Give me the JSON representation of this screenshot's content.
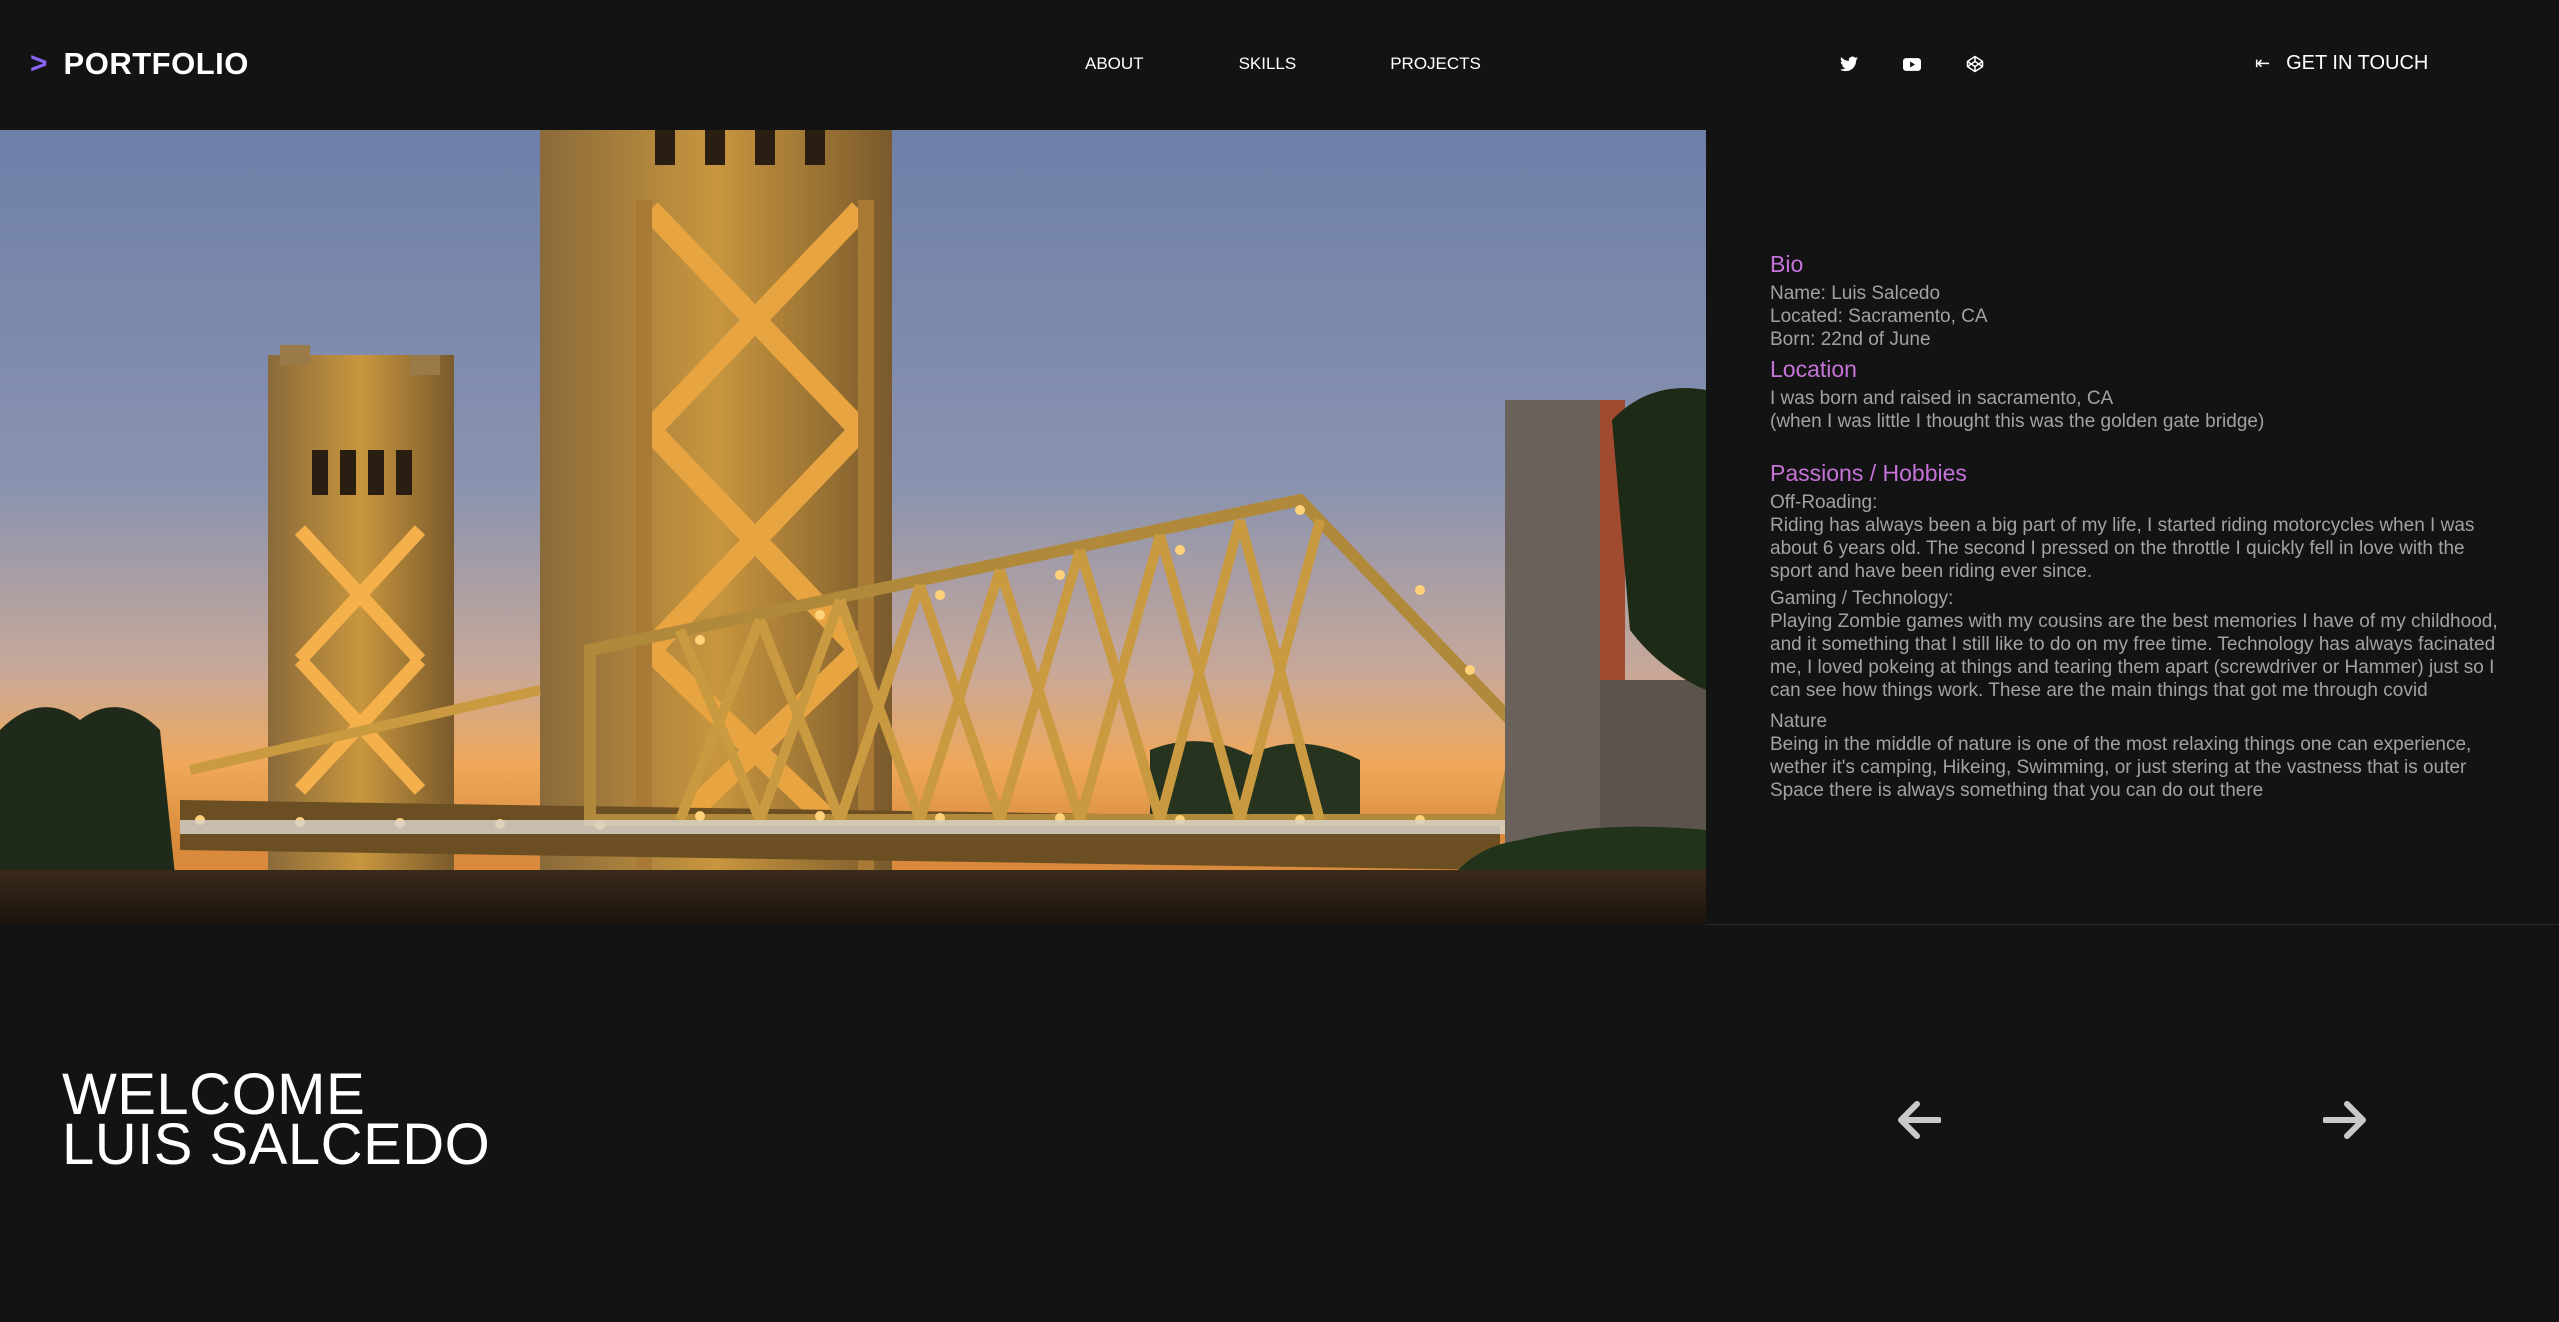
{
  "header": {
    "brand_arrow": ">",
    "brand_name": "PORTFOLIO",
    "nav": {
      "about": "ABOUT",
      "skills": "SKILLS",
      "projects": "PROJECTS"
    },
    "social_icons": [
      "twitter-icon",
      "youtube-icon",
      "codepen-icon"
    ],
    "cta_icon": "⇤",
    "cta_label": "GET IN TOUCH"
  },
  "bio": {
    "bio_heading": "Bio",
    "name_line": "Name: Luis Salcedo",
    "located_line": "Located: Sacramento, CA",
    "born_line": "Born: 22nd of June",
    "location_heading": "Location",
    "location_line1": "I was born and raised in sacramento, CA",
    "location_line2": "(when I was little I thought this was the golden gate bridge)",
    "passions_heading": "Passions / Hobbies",
    "offroading_title": "Off-Roading:",
    "offroading_text": "Riding has always been a big part of my life, I started riding motorcycles when I was about 6 years old. The second I pressed on the throttle I quickly fell in love with the sport and have been riding ever since.",
    "gaming_title": "Gaming / Technology:",
    "gaming_text": "Playing Zombie games with my cousins are the best memories I have of my childhood, and it something that I still like to do on my free time. Technology has always facinated me, I loved pokeing at things and tearing them apart (screwdriver or Hammer) just so I can see how things work. These are the main things that got me through covid",
    "nature_title": "Nature",
    "nature_text": "Being in the middle of nature is one of the most relaxing things one can experience, wether it's camping, Hikeing, Swimming, or just stering at the vastness that is outer Space there is always something that you can do out there"
  },
  "welcome": {
    "line1": "WELCOME",
    "line2": "LUIS SALCEDO"
  },
  "colors": {
    "accent": "#8a63f5",
    "heading": "#c673d9",
    "text": "#a2a2a2",
    "background": "#131313"
  }
}
